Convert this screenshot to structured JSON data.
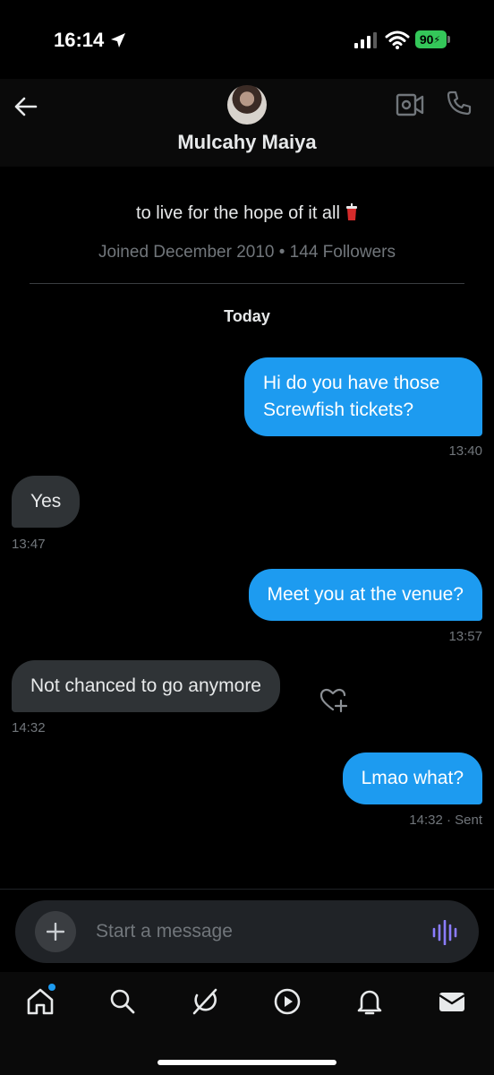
{
  "status_bar": {
    "time": "16:14",
    "battery": "90"
  },
  "header": {
    "contact_name": "Mulcahy Maiya"
  },
  "profile": {
    "bio": "to live for the hope of it all",
    "meta": "Joined December 2010 • 144 Followers"
  },
  "conversation": {
    "day_label": "Today",
    "messages": [
      {
        "direction": "outgoing",
        "text": "Hi do you have those Screwfish tickets?",
        "time": "13:40"
      },
      {
        "direction": "incoming",
        "text": "Yes",
        "time": "13:47"
      },
      {
        "direction": "outgoing",
        "text": "Meet you at the venue?",
        "time": "13:57"
      },
      {
        "direction": "incoming",
        "text": "Not chanced to go anymore",
        "time": "14:32"
      },
      {
        "direction": "outgoing",
        "text": "Lmao what?",
        "time": "14:32 · Sent"
      }
    ]
  },
  "composer": {
    "placeholder": "Start a message"
  },
  "colors": {
    "accent": "#1d9bf0",
    "incoming_bubble": "#2f3336",
    "background": "#000000",
    "voice_icon": "#8b7cff"
  },
  "icons": [
    "location-arrow-icon",
    "signal-icon",
    "wifi-icon",
    "back-arrow-icon",
    "video-call-icon",
    "phone-icon",
    "add-reaction-icon",
    "plus-icon",
    "voice-message-icon",
    "home-icon",
    "search-icon",
    "grok-icon",
    "play-icon",
    "bell-icon",
    "mail-icon"
  ]
}
